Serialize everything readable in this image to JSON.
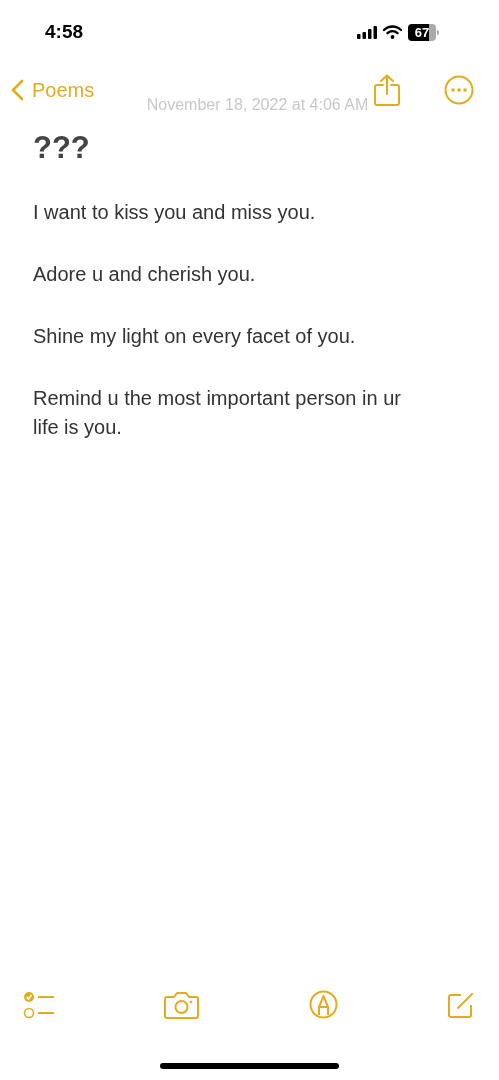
{
  "status_bar": {
    "time": "4:58",
    "battery": "67"
  },
  "nav": {
    "back_label": "Poems",
    "date": "November 18, 2022 at 4:06 AM"
  },
  "note": {
    "title": "???",
    "paragraphs": [
      "I want to kiss you and miss you.",
      "Adore u and cherish you.",
      "Shine my light on every facet of you.",
      "Remind u the most important person in ur life is you."
    ]
  }
}
